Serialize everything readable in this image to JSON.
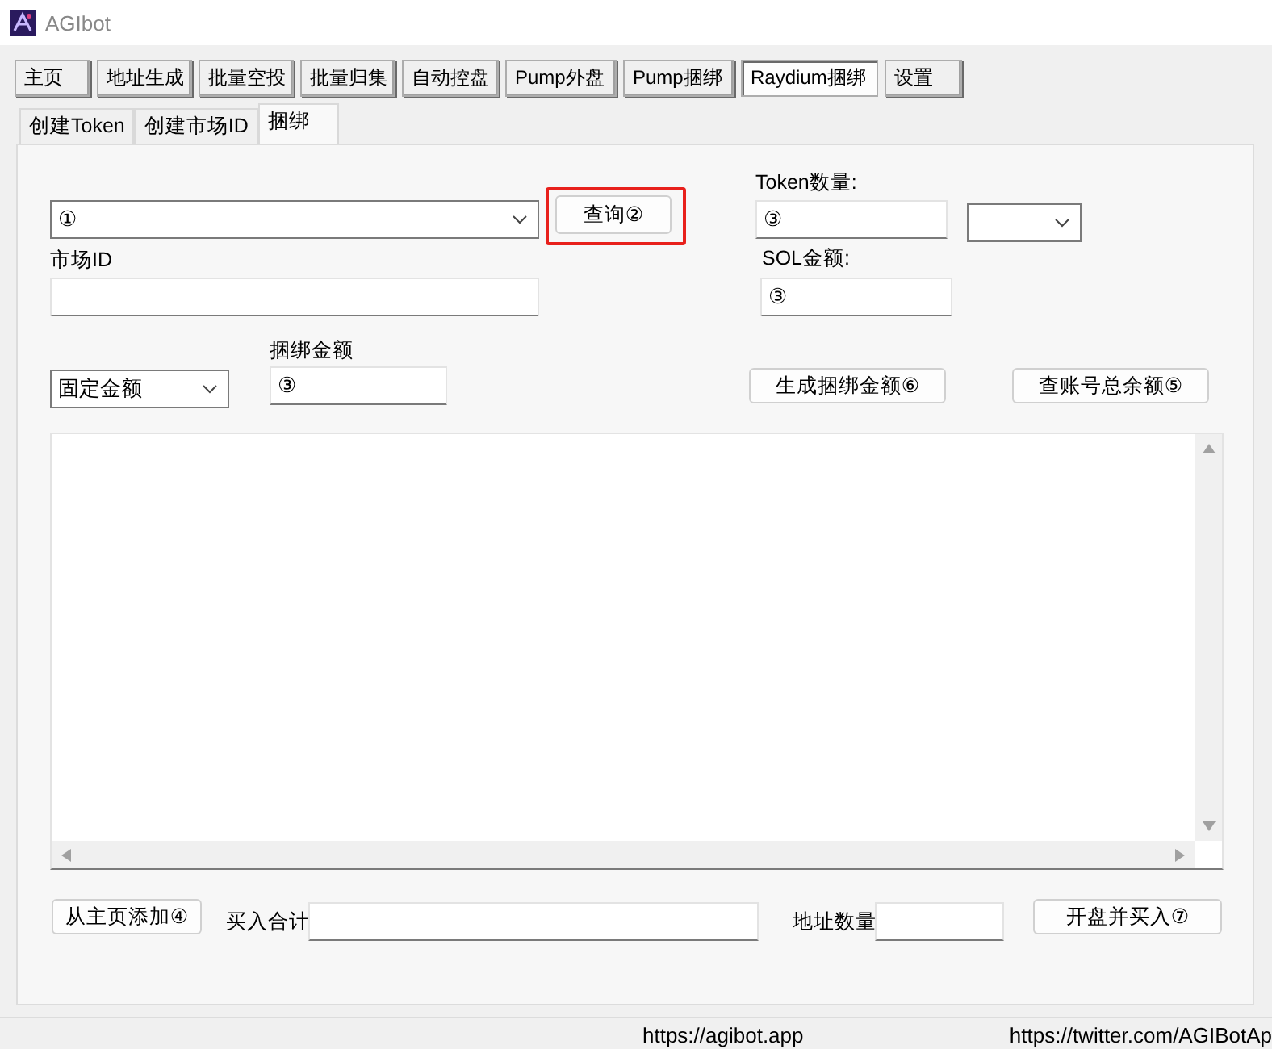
{
  "window": {
    "title": "AGIbot"
  },
  "nav_buttons": [
    {
      "label": "主页",
      "selected": false
    },
    {
      "label": "地址生成",
      "selected": false
    },
    {
      "label": "批量空投",
      "selected": false
    },
    {
      "label": "批量归集",
      "selected": false
    },
    {
      "label": "自动控盘",
      "selected": false
    },
    {
      "label": "Pump外盘",
      "selected": false
    },
    {
      "label": "Pump捆绑",
      "selected": false
    },
    {
      "label": "Raydium捆绑",
      "selected": true
    },
    {
      "label": "设置",
      "selected": false
    }
  ],
  "tabs": [
    {
      "label": "创建Token",
      "selected": false
    },
    {
      "label": "创建市场ID",
      "selected": false
    },
    {
      "label": "捆绑",
      "selected": true
    }
  ],
  "form": {
    "token_combo": {
      "value": "①"
    },
    "query_button": {
      "label": "查询②",
      "highlighted": true
    },
    "token_amount": {
      "label": "Token数量:",
      "value": "③"
    },
    "market_id": {
      "label": "市场ID"
    },
    "sol_amount": {
      "label": "SOL金额:",
      "value": "③"
    },
    "amount_mode": {
      "value": "固定金额"
    },
    "bundle_amount": {
      "label": "捆绑金额",
      "value": "③"
    },
    "generate_button": {
      "label": "生成捆绑金额⑥"
    },
    "balance_button": {
      "label": "查账号总余额⑤"
    },
    "add_button": {
      "label": "从主页添加④"
    },
    "buy_total": {
      "label": "买入合计"
    },
    "address_count": {
      "label": "地址数量"
    },
    "open_buy_button": {
      "label": "开盘并买入⑦"
    }
  },
  "status_bar": [
    "https://agibot.app",
    "https://twitter.com/AGIBotAp"
  ]
}
